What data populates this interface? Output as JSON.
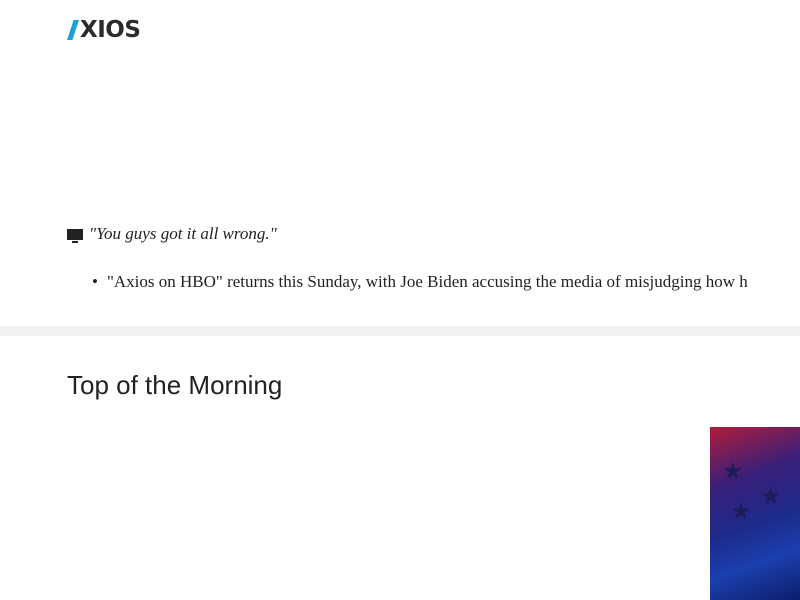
{
  "header": {
    "logo_text": "XIOS",
    "logo_alt": "AXIOS"
  },
  "story": {
    "quote": "\"You guys got it all wrong.\"",
    "icon": "tv-icon",
    "bullet": "\"Axios on HBO\" returns this Sunday, with Joe Biden accusing the media of misjudging how h"
  },
  "section": {
    "title": "Top of the Morning"
  },
  "colors": {
    "accent": "#1ea1d2",
    "band": "#f2f2f2"
  }
}
